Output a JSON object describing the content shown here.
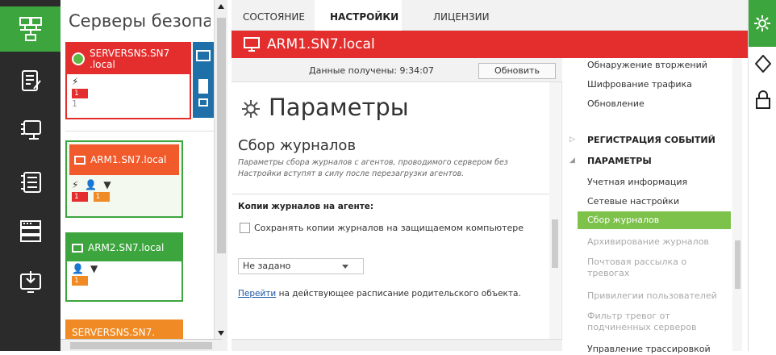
{
  "colors": {
    "nav_bg": "#2b2b2b",
    "accent_green": "#3da53d",
    "alert_red": "#e42e2e",
    "orange": "#f08a24",
    "selected_green": "#7dc24b"
  },
  "left_nav": [
    {
      "icon": "network-icon",
      "active": true
    },
    {
      "icon": "log-icon",
      "active": false
    },
    {
      "icon": "computer-settings-icon",
      "active": false
    },
    {
      "icon": "server-list-icon",
      "active": false
    },
    {
      "icon": "rack-icon",
      "active": false
    },
    {
      "icon": "download-icon",
      "active": false
    }
  ],
  "server_panel": {
    "title": "Серверы безопаснос",
    "cards": [
      {
        "name": "SERVERSNS.SN7\n.local",
        "counts": [
          "1",
          "1"
        ]
      },
      {
        "name": "ARM1.SN7.local",
        "counts": [
          "1",
          "1"
        ]
      },
      {
        "name": "ARM2.SN7.local",
        "counts": [
          "1"
        ]
      },
      {
        "name": "SERVERSNS.SN7."
      }
    ]
  },
  "tabs": [
    "СОСТОЯНИЕ",
    "НАСТРОЙКИ",
    "ЛИЦЕНЗИИ"
  ],
  "active_tab": "НАСТРОЙКИ",
  "header": {
    "title": "ARM1.SN7.local"
  },
  "infobar": {
    "label": "Данные получены: 9:34:07",
    "refresh": "Обновить"
  },
  "content": {
    "page_title": "Параметры",
    "section_title": "Сбор журналов",
    "section_desc_1": "Параметры сбора журналов с агентов, проводимого сервером без",
    "section_desc_2": "Настройки вступят в силу после перезагрузки агентов.",
    "copies_label": "Копии журналов на агенте:",
    "checkbox_label": "Сохранять копии журналов на защищаемом компьютере",
    "select_value": "Не задано",
    "goto_link": "Перейти",
    "goto_rest": " на  действующее расписание родительского объекта."
  },
  "tree": {
    "items": [
      {
        "label": "Обнаружение вторжений",
        "kind": "normal"
      },
      {
        "label": "Шифрование трафика",
        "kind": "normal"
      },
      {
        "label": "Обновление",
        "kind": "normal"
      },
      {
        "label": "РЕГИСТРАЦИЯ СОБЫТИЙ",
        "kind": "header-collapsed"
      },
      {
        "label": "ПАРАМЕТРЫ",
        "kind": "header-expanded"
      },
      {
        "label": "Учетная информация",
        "kind": "normal"
      },
      {
        "label": "Сетевые настройки",
        "kind": "normal"
      },
      {
        "label": "Сбор журналов",
        "kind": "selected"
      },
      {
        "label": "Архивирование журналов",
        "kind": "disabled"
      },
      {
        "label": "Почтовая рассылка о",
        "label2": "тревогах",
        "kind": "disabled"
      },
      {
        "label": "Привилегии пользователей",
        "kind": "disabled"
      },
      {
        "label": "Фильтр тревог от",
        "label2": "подчиненных серверов",
        "kind": "disabled"
      },
      {
        "label": "Управление трассировкой",
        "kind": "normal"
      }
    ]
  },
  "right_toolbar": [
    "settings-gear-icon",
    "diamond-nav-icon",
    "lock-settings-icon"
  ]
}
